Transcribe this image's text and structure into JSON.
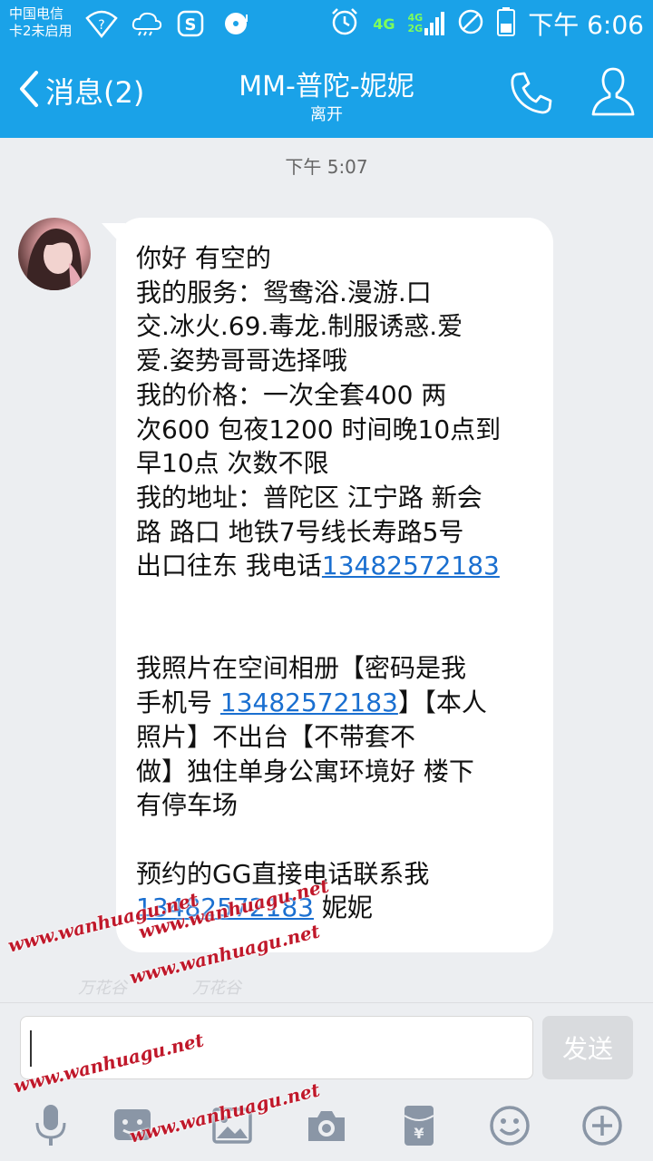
{
  "status_bar": {
    "carrier_line1": "中国电信",
    "carrier_line2": "卡2未启用",
    "network_4g": "4G",
    "network_4g_small": "4G",
    "network_2g_small": "2G",
    "time": "下午 6:06",
    "icons": [
      "wifi-question-icon",
      "weather-cloud-icon",
      "app-s-icon",
      "music-disc-icon",
      "alarm-icon",
      "do-not-disturb-icon",
      "battery-icon"
    ]
  },
  "title_bar": {
    "back_label": "消息(2)",
    "contact_name": "MM-普陀-妮妮",
    "status": "离开",
    "icons": [
      "back-arrow-icon",
      "phone-icon",
      "profile-icon"
    ]
  },
  "chat": {
    "timestamp": "下午 5:07",
    "message_lines": [
      "你好 有空的",
      "我的服务：鸳鸯浴.漫游.口",
      "交.冰火.69.毒龙.制服诱惑.爱",
      "爱.姿势哥哥选择哦",
      "我的价格：一次全套400 两",
      "次600 包夜1200 时间晚10点到",
      "早10点 次数不限",
      "我的地址：普陀区 江宁路 新会",
      "路 路口  地铁7号线长寿路5号"
    ],
    "line_exit_prefix": "出口往东 我电话",
    "phone_number": "13482572183",
    "photo_line1": "我照片在空间相册【密码是我",
    "photo_line2_prefix": "手机号 ",
    "photo_line2_suffix": "】【本人",
    "photo_line3": "照片】不出台【不带套不",
    "photo_line4": "做】独住单身公寓环境好 楼下",
    "photo_line5": "有停车场",
    "contact_line1": "预约的GG直接电话联系我",
    "contact_suffix": " 妮妮"
  },
  "watermarks": {
    "text": "www.wanhuagu.net",
    "faint_text": "万花谷"
  },
  "input": {
    "value": "",
    "send_label": "发送"
  },
  "toolbar": {
    "icons": [
      "microphone-icon",
      "sticker-icon",
      "image-icon",
      "camera-icon",
      "red-packet-icon",
      "emoji-icon",
      "plus-icon"
    ]
  },
  "colors": {
    "header_blue": "#1aa2e8",
    "link_blue": "#1a6fd0",
    "watermark_red": "#c0182a",
    "background": "#eceef1"
  }
}
